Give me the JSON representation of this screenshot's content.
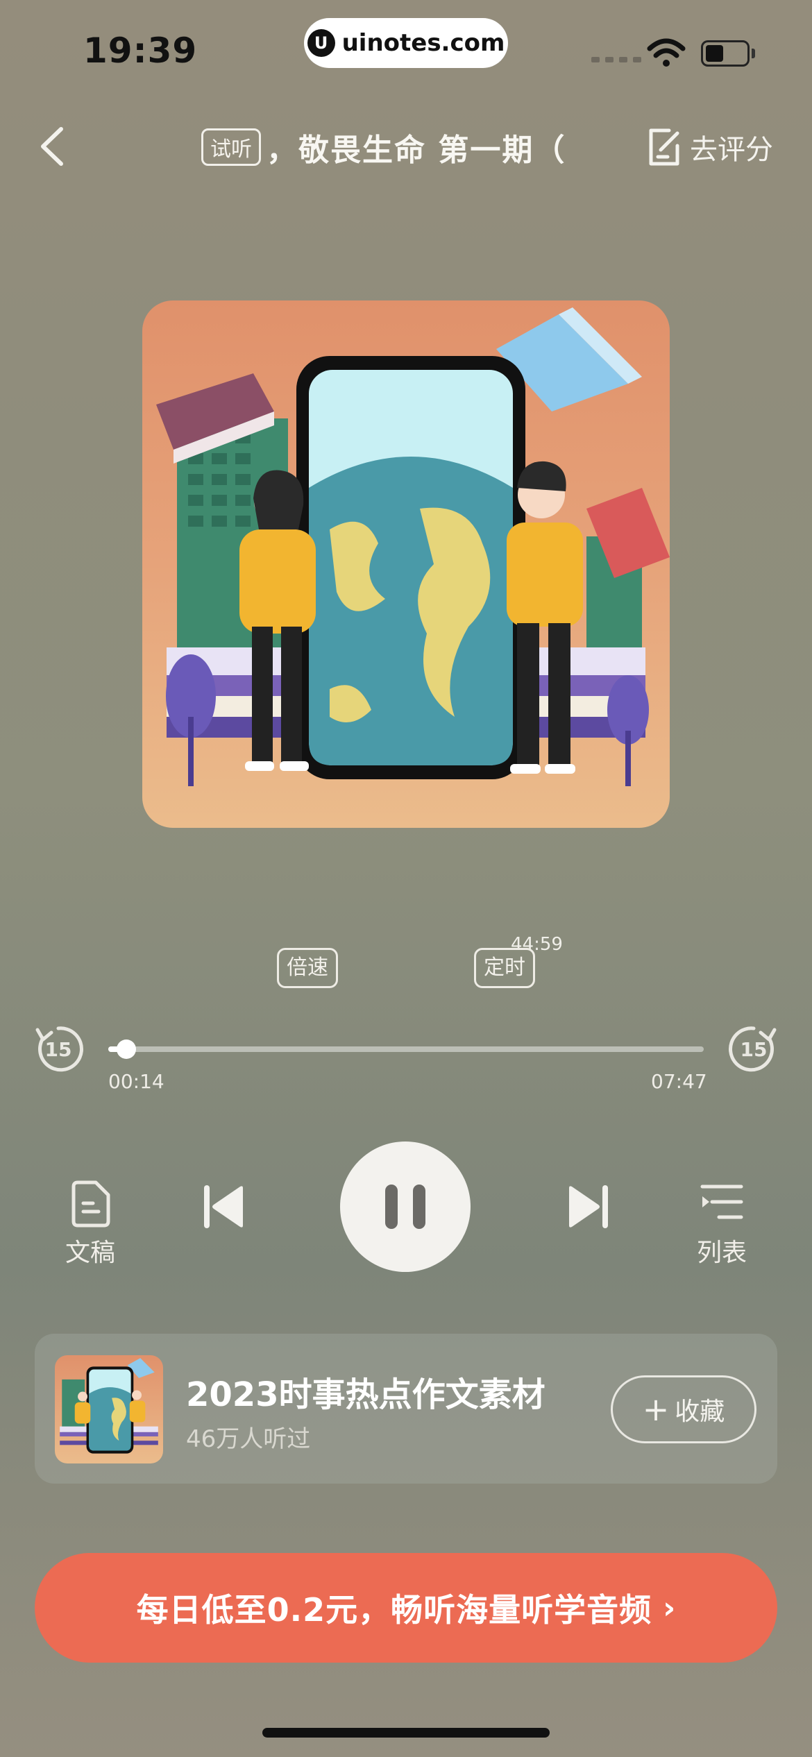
{
  "status_bar": {
    "time": "19:39",
    "url": "uinotes.com",
    "url_logo": "U"
  },
  "nav": {
    "trial_badge": "试听",
    "title": "，敬畏生命    第一期（",
    "rate_label": "去评分"
  },
  "controls": {
    "speed_label": "倍速",
    "timer_label": "定时",
    "timer_remaining": "44:59",
    "skip_back_label": "15",
    "skip_forward_label": "15",
    "current_time": "00:14",
    "total_time": "07:47",
    "progress": 0.03,
    "transcript_label": "文稿",
    "playlist_label": "列表"
  },
  "album": {
    "title": "2023时事热点作文素材",
    "listeners": "46万人听过",
    "favorite_label": "收藏",
    "favorite_plus": "+"
  },
  "promo": {
    "text": "每日低至0.2元，畅听海量听学音频",
    "arrow": "›"
  },
  "colors": {
    "promo": "#ec6b53",
    "play_button": "#f3f2ee",
    "cover_top": "#e0916b",
    "cover_bottom": "#ebbc8c"
  }
}
